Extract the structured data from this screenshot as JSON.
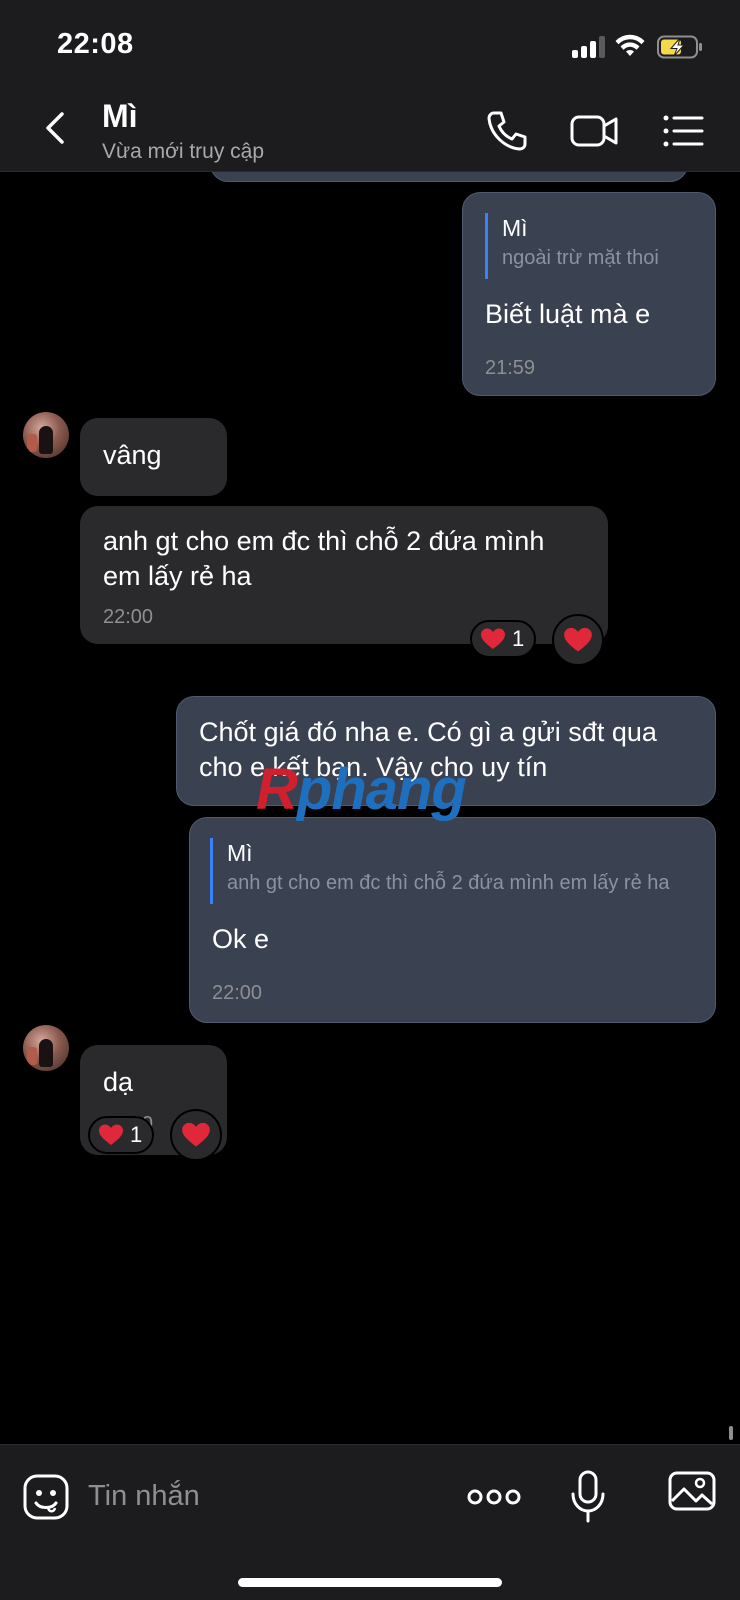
{
  "status_bar": {
    "time": "22:08"
  },
  "header": {
    "contact_name": "Mì",
    "contact_status": "Vừa mới truy cập"
  },
  "messages": [
    {
      "direction": "out",
      "quote": {
        "name": "Mì",
        "text": "ngoài trừ mặt thoi"
      },
      "text": "Biết luật mà e",
      "time": "21:59"
    },
    {
      "direction": "in",
      "text": "vâng"
    },
    {
      "direction": "in",
      "lines": [
        "anh gt cho em đc thì chỗ 2 đứa mình",
        "em lấy rẻ ha"
      ],
      "time": "22:00",
      "reaction_count": "1"
    },
    {
      "direction": "out",
      "lines": [
        "Chốt giá đó nha e. Có gì a gửi sđt qua",
        "cho e kết bạn. Vậy cho uy tín"
      ]
    },
    {
      "direction": "out",
      "quote": {
        "name": "Mì",
        "text": "anh gt cho em đc thì chỗ 2 đứa mình em lấy rẻ ha"
      },
      "text": "Ok e",
      "time": "22:00"
    },
    {
      "direction": "in",
      "text": "dạ",
      "time": "22:00",
      "reaction_count": "1"
    }
  ],
  "watermark": {
    "first": "R",
    "rest": "phang"
  },
  "composer": {
    "placeholder": "Tin nhắn"
  },
  "colors": {
    "outgoing_bubble": "#3a4150",
    "incoming_bubble": "#2a2a2c",
    "quote_bar": "#3b82f6",
    "heart": "#e0283a",
    "battery_charging": "#f5d94a"
  },
  "icons": [
    "back-chevron-icon",
    "phone-icon",
    "video-camera-icon",
    "list-menu-icon",
    "sticker-icon",
    "more-dots-icon",
    "microphone-icon",
    "image-icon",
    "heart-icon"
  ]
}
